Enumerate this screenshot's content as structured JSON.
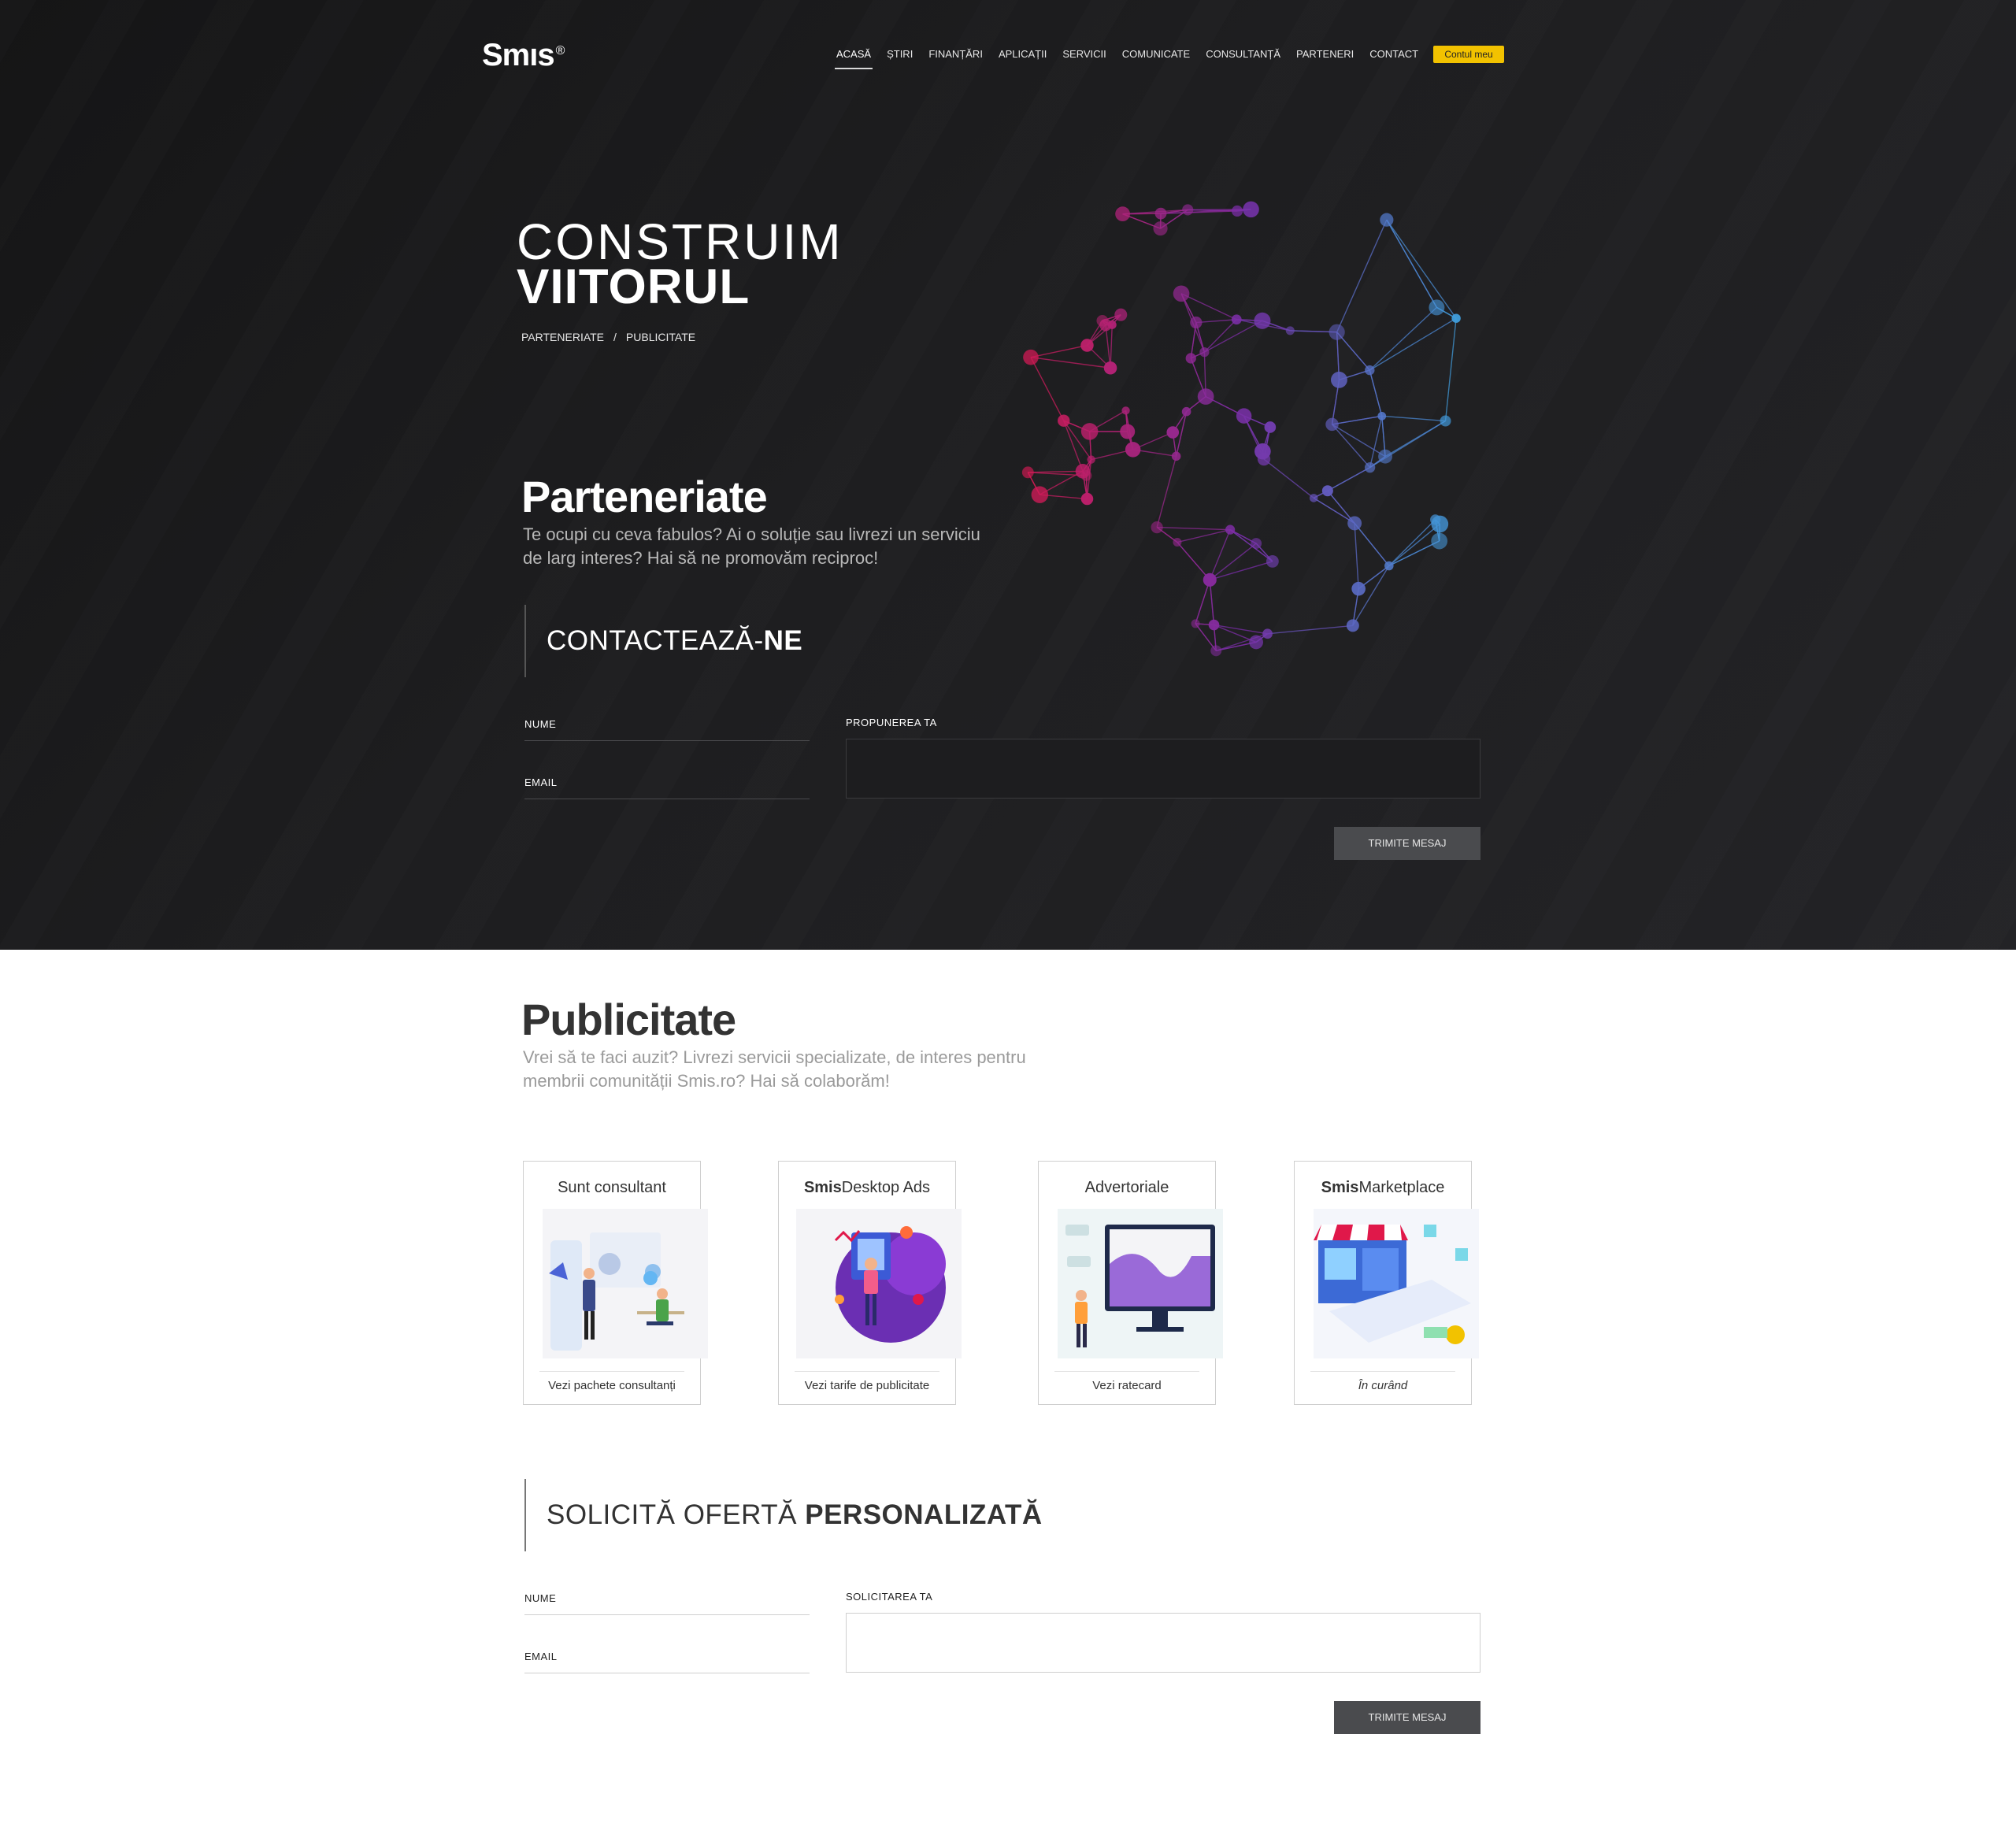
{
  "brand": {
    "logo_text": "Smıs",
    "logo_mark": "®"
  },
  "nav": {
    "items": [
      "ACASĂ",
      "ȘTIRI",
      "FINANȚĂRI",
      "APLICAȚII",
      "SERVICII",
      "COMUNICATE",
      "CONSULTANȚĂ",
      "PARTENERI",
      "CONTACT"
    ],
    "active": "ACASĂ",
    "account_button": "Contul meu"
  },
  "hero": {
    "title_line1": "CONSTRUIM",
    "title_line2": "VIITORUL",
    "breadcrumb": [
      "PARTENERIATE",
      "PUBLICITATE"
    ],
    "breadcrumb_separator": "/"
  },
  "partnerships": {
    "title": "Parteneriate",
    "description": "Te ocupi cu ceva fabulos? Ai o soluție sau livrezi un serviciu de larg interes? Hai să ne promovăm reciproc!",
    "contact_label_light": "CONTACTEAZĂ-",
    "contact_label_bold": "NE",
    "form": {
      "name_label": "NUME",
      "email_label": "EMAIL",
      "message_label": "PROPUNEREA TA",
      "submit": "TRIMITE MESAJ"
    }
  },
  "advertising": {
    "title": "Publicitate",
    "description": "Vrei să te faci auzit? Livrezi servicii specializate, de interes pentru membrii comunității Smis.ro? Hai să colaborăm!",
    "cards": [
      {
        "title_bold": "",
        "title": "Sunt consultant",
        "link": "Vezi pachete consultanți"
      },
      {
        "title_bold": "Smis",
        "title": "Desktop Ads",
        "link": "Vezi tarife de publicitate"
      },
      {
        "title_bold": "",
        "title": "Advertoriale",
        "link": "Vezi ratecard"
      },
      {
        "title_bold": "Smis",
        "title": "Marketplace",
        "link": "În curând"
      }
    ],
    "offer_label_light": "SOLICITĂ OFERTĂ ",
    "offer_label_bold": "PERSONALIZATĂ",
    "form": {
      "name_label": "NUME",
      "email_label": "EMAIL",
      "message_label": "SOLICITAREA TA",
      "submit": "TRIMITE MESAJ"
    }
  },
  "colors": {
    "hero_bg": "#1b1b1d",
    "accent_yellow": "#f2c200",
    "button_gray": "#4a4b4e",
    "globe_red": "#e0184a",
    "globe_purple": "#7a2ea8",
    "globe_blue": "#3aa8e0"
  }
}
